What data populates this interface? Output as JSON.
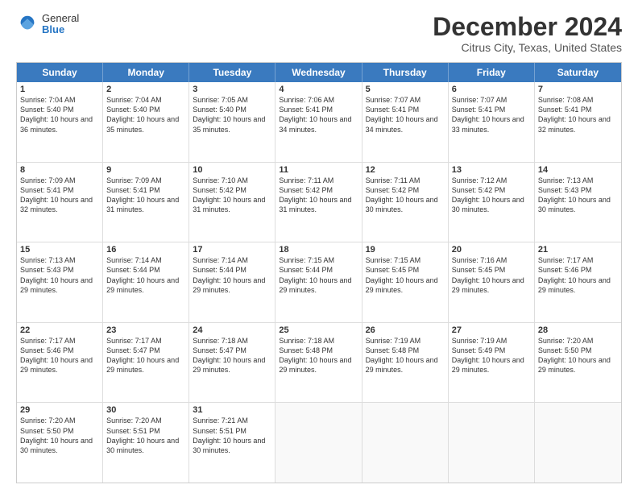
{
  "logo": {
    "general": "General",
    "blue": "Blue"
  },
  "title": "December 2024",
  "subtitle": "Citrus City, Texas, United States",
  "days": [
    "Sunday",
    "Monday",
    "Tuesday",
    "Wednesday",
    "Thursday",
    "Friday",
    "Saturday"
  ],
  "weeks": [
    [
      {
        "day": "1",
        "sunrise": "7:04 AM",
        "sunset": "5:40 PM",
        "daylight": "10 hours and 36 minutes."
      },
      {
        "day": "2",
        "sunrise": "7:04 AM",
        "sunset": "5:40 PM",
        "daylight": "10 hours and 35 minutes."
      },
      {
        "day": "3",
        "sunrise": "7:05 AM",
        "sunset": "5:40 PM",
        "daylight": "10 hours and 35 minutes."
      },
      {
        "day": "4",
        "sunrise": "7:06 AM",
        "sunset": "5:41 PM",
        "daylight": "10 hours and 34 minutes."
      },
      {
        "day": "5",
        "sunrise": "7:07 AM",
        "sunset": "5:41 PM",
        "daylight": "10 hours and 34 minutes."
      },
      {
        "day": "6",
        "sunrise": "7:07 AM",
        "sunset": "5:41 PM",
        "daylight": "10 hours and 33 minutes."
      },
      {
        "day": "7",
        "sunrise": "7:08 AM",
        "sunset": "5:41 PM",
        "daylight": "10 hours and 32 minutes."
      }
    ],
    [
      {
        "day": "8",
        "sunrise": "7:09 AM",
        "sunset": "5:41 PM",
        "daylight": "10 hours and 32 minutes."
      },
      {
        "day": "9",
        "sunrise": "7:09 AM",
        "sunset": "5:41 PM",
        "daylight": "10 hours and 31 minutes."
      },
      {
        "day": "10",
        "sunrise": "7:10 AM",
        "sunset": "5:42 PM",
        "daylight": "10 hours and 31 minutes."
      },
      {
        "day": "11",
        "sunrise": "7:11 AM",
        "sunset": "5:42 PM",
        "daylight": "10 hours and 31 minutes."
      },
      {
        "day": "12",
        "sunrise": "7:11 AM",
        "sunset": "5:42 PM",
        "daylight": "10 hours and 30 minutes."
      },
      {
        "day": "13",
        "sunrise": "7:12 AM",
        "sunset": "5:42 PM",
        "daylight": "10 hours and 30 minutes."
      },
      {
        "day": "14",
        "sunrise": "7:13 AM",
        "sunset": "5:43 PM",
        "daylight": "10 hours and 30 minutes."
      }
    ],
    [
      {
        "day": "15",
        "sunrise": "7:13 AM",
        "sunset": "5:43 PM",
        "daylight": "10 hours and 29 minutes."
      },
      {
        "day": "16",
        "sunrise": "7:14 AM",
        "sunset": "5:44 PM",
        "daylight": "10 hours and 29 minutes."
      },
      {
        "day": "17",
        "sunrise": "7:14 AM",
        "sunset": "5:44 PM",
        "daylight": "10 hours and 29 minutes."
      },
      {
        "day": "18",
        "sunrise": "7:15 AM",
        "sunset": "5:44 PM",
        "daylight": "10 hours and 29 minutes."
      },
      {
        "day": "19",
        "sunrise": "7:15 AM",
        "sunset": "5:45 PM",
        "daylight": "10 hours and 29 minutes."
      },
      {
        "day": "20",
        "sunrise": "7:16 AM",
        "sunset": "5:45 PM",
        "daylight": "10 hours and 29 minutes."
      },
      {
        "day": "21",
        "sunrise": "7:17 AM",
        "sunset": "5:46 PM",
        "daylight": "10 hours and 29 minutes."
      }
    ],
    [
      {
        "day": "22",
        "sunrise": "7:17 AM",
        "sunset": "5:46 PM",
        "daylight": "10 hours and 29 minutes."
      },
      {
        "day": "23",
        "sunrise": "7:17 AM",
        "sunset": "5:47 PM",
        "daylight": "10 hours and 29 minutes."
      },
      {
        "day": "24",
        "sunrise": "7:18 AM",
        "sunset": "5:47 PM",
        "daylight": "10 hours and 29 minutes."
      },
      {
        "day": "25",
        "sunrise": "7:18 AM",
        "sunset": "5:48 PM",
        "daylight": "10 hours and 29 minutes."
      },
      {
        "day": "26",
        "sunrise": "7:19 AM",
        "sunset": "5:48 PM",
        "daylight": "10 hours and 29 minutes."
      },
      {
        "day": "27",
        "sunrise": "7:19 AM",
        "sunset": "5:49 PM",
        "daylight": "10 hours and 29 minutes."
      },
      {
        "day": "28",
        "sunrise": "7:20 AM",
        "sunset": "5:50 PM",
        "daylight": "10 hours and 29 minutes."
      }
    ],
    [
      {
        "day": "29",
        "sunrise": "7:20 AM",
        "sunset": "5:50 PM",
        "daylight": "10 hours and 30 minutes."
      },
      {
        "day": "30",
        "sunrise": "7:20 AM",
        "sunset": "5:51 PM",
        "daylight": "10 hours and 30 minutes."
      },
      {
        "day": "31",
        "sunrise": "7:21 AM",
        "sunset": "5:51 PM",
        "daylight": "10 hours and 30 minutes."
      },
      null,
      null,
      null,
      null
    ]
  ]
}
